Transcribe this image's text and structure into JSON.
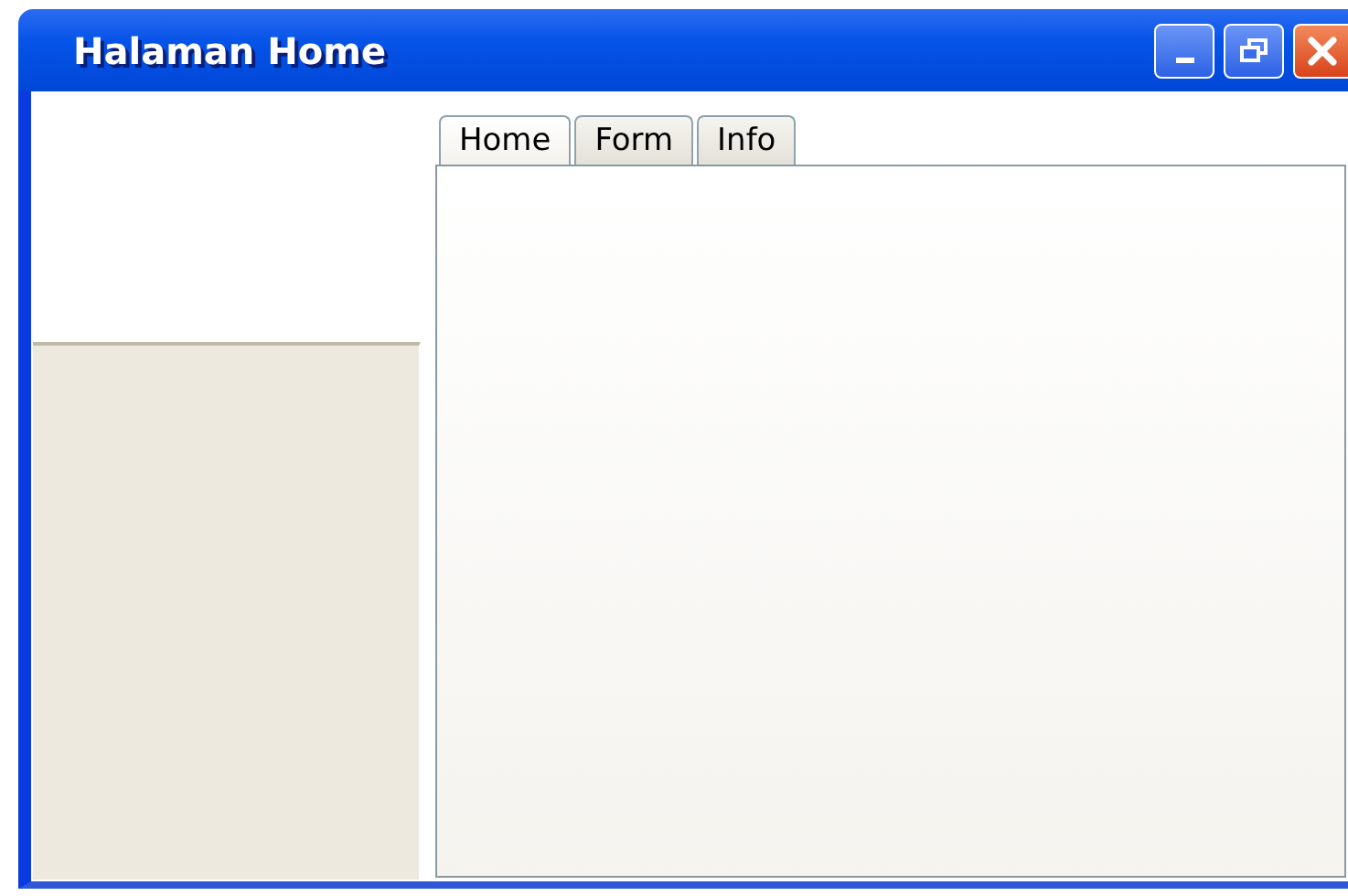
{
  "window": {
    "title": "Halaman Home"
  },
  "tabs": [
    {
      "label": "Home",
      "selected": true
    },
    {
      "label": "Form",
      "selected": false
    },
    {
      "label": "Info",
      "selected": false
    }
  ]
}
